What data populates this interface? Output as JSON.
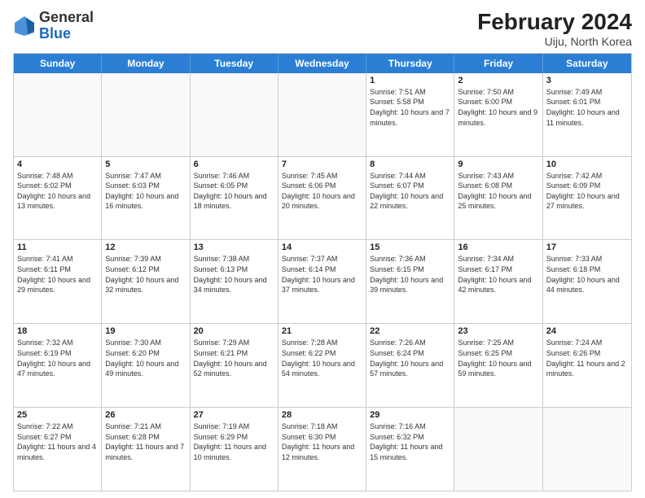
{
  "header": {
    "logo_general": "General",
    "logo_blue": "Blue",
    "month_year": "February 2024",
    "location": "Uiju, North Korea"
  },
  "days_of_week": [
    "Sunday",
    "Monday",
    "Tuesday",
    "Wednesday",
    "Thursday",
    "Friday",
    "Saturday"
  ],
  "weeks": [
    [
      {
        "day": "",
        "empty": true
      },
      {
        "day": "",
        "empty": true
      },
      {
        "day": "",
        "empty": true
      },
      {
        "day": "",
        "empty": true
      },
      {
        "day": "1",
        "sunrise": "7:51 AM",
        "sunset": "5:58 PM",
        "daylight": "10 hours and 7 minutes."
      },
      {
        "day": "2",
        "sunrise": "7:50 AM",
        "sunset": "6:00 PM",
        "daylight": "10 hours and 9 minutes."
      },
      {
        "day": "3",
        "sunrise": "7:49 AM",
        "sunset": "6:01 PM",
        "daylight": "10 hours and 11 minutes."
      }
    ],
    [
      {
        "day": "4",
        "sunrise": "7:48 AM",
        "sunset": "6:02 PM",
        "daylight": "10 hours and 13 minutes."
      },
      {
        "day": "5",
        "sunrise": "7:47 AM",
        "sunset": "6:03 PM",
        "daylight": "10 hours and 16 minutes."
      },
      {
        "day": "6",
        "sunrise": "7:46 AM",
        "sunset": "6:05 PM",
        "daylight": "10 hours and 18 minutes."
      },
      {
        "day": "7",
        "sunrise": "7:45 AM",
        "sunset": "6:06 PM",
        "daylight": "10 hours and 20 minutes."
      },
      {
        "day": "8",
        "sunrise": "7:44 AM",
        "sunset": "6:07 PM",
        "daylight": "10 hours and 22 minutes."
      },
      {
        "day": "9",
        "sunrise": "7:43 AM",
        "sunset": "6:08 PM",
        "daylight": "10 hours and 25 minutes."
      },
      {
        "day": "10",
        "sunrise": "7:42 AM",
        "sunset": "6:09 PM",
        "daylight": "10 hours and 27 minutes."
      }
    ],
    [
      {
        "day": "11",
        "sunrise": "7:41 AM",
        "sunset": "6:11 PM",
        "daylight": "10 hours and 29 minutes."
      },
      {
        "day": "12",
        "sunrise": "7:39 AM",
        "sunset": "6:12 PM",
        "daylight": "10 hours and 32 minutes."
      },
      {
        "day": "13",
        "sunrise": "7:38 AM",
        "sunset": "6:13 PM",
        "daylight": "10 hours and 34 minutes."
      },
      {
        "day": "14",
        "sunrise": "7:37 AM",
        "sunset": "6:14 PM",
        "daylight": "10 hours and 37 minutes."
      },
      {
        "day": "15",
        "sunrise": "7:36 AM",
        "sunset": "6:15 PM",
        "daylight": "10 hours and 39 minutes."
      },
      {
        "day": "16",
        "sunrise": "7:34 AM",
        "sunset": "6:17 PM",
        "daylight": "10 hours and 42 minutes."
      },
      {
        "day": "17",
        "sunrise": "7:33 AM",
        "sunset": "6:18 PM",
        "daylight": "10 hours and 44 minutes."
      }
    ],
    [
      {
        "day": "18",
        "sunrise": "7:32 AM",
        "sunset": "6:19 PM",
        "daylight": "10 hours and 47 minutes."
      },
      {
        "day": "19",
        "sunrise": "7:30 AM",
        "sunset": "6:20 PM",
        "daylight": "10 hours and 49 minutes."
      },
      {
        "day": "20",
        "sunrise": "7:29 AM",
        "sunset": "6:21 PM",
        "daylight": "10 hours and 52 minutes."
      },
      {
        "day": "21",
        "sunrise": "7:28 AM",
        "sunset": "6:22 PM",
        "daylight": "10 hours and 54 minutes."
      },
      {
        "day": "22",
        "sunrise": "7:26 AM",
        "sunset": "6:24 PM",
        "daylight": "10 hours and 57 minutes."
      },
      {
        "day": "23",
        "sunrise": "7:25 AM",
        "sunset": "6:25 PM",
        "daylight": "10 hours and 59 minutes."
      },
      {
        "day": "24",
        "sunrise": "7:24 AM",
        "sunset": "6:26 PM",
        "daylight": "11 hours and 2 minutes."
      }
    ],
    [
      {
        "day": "25",
        "sunrise": "7:22 AM",
        "sunset": "6:27 PM",
        "daylight": "11 hours and 4 minutes."
      },
      {
        "day": "26",
        "sunrise": "7:21 AM",
        "sunset": "6:28 PM",
        "daylight": "11 hours and 7 minutes."
      },
      {
        "day": "27",
        "sunrise": "7:19 AM",
        "sunset": "6:29 PM",
        "daylight": "11 hours and 10 minutes."
      },
      {
        "day": "28",
        "sunrise": "7:18 AM",
        "sunset": "6:30 PM",
        "daylight": "11 hours and 12 minutes."
      },
      {
        "day": "29",
        "sunrise": "7:16 AM",
        "sunset": "6:32 PM",
        "daylight": "11 hours and 15 minutes."
      },
      {
        "day": "",
        "empty": true
      },
      {
        "day": "",
        "empty": true
      }
    ]
  ]
}
